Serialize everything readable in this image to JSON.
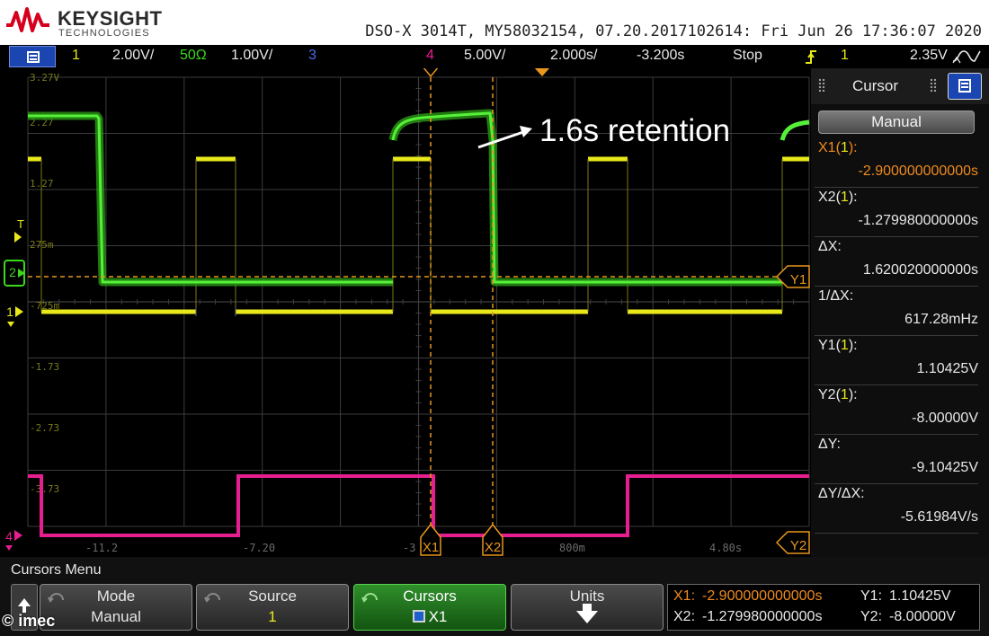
{
  "header": {
    "brand": "KEYSIGHT",
    "brand_sub": "TECHNOLOGIES",
    "device_info": "DSO-X 3014T, MY58032154, 07.20.2017102614: Fri Jun 26 17:36:07 2020"
  },
  "channel_bar": {
    "ch1_num": "1",
    "ch1_scale": "2.00V/",
    "ch2_num": "50Ω",
    "ch2_scale": "1.00V/",
    "ch3_num": "3",
    "ch4_num": "4",
    "ch4_scale": "5.00V/",
    "timebase": "2.000s/",
    "delay": "-3.200s",
    "run_state": "Stop",
    "trigger_source": "1",
    "trigger_level": "2.35V"
  },
  "screen": {
    "grid_labels": [
      "3.27V",
      "2.27",
      "1.27",
      "275m",
      "-725m",
      "-1.73",
      "-2.73",
      "-3.73"
    ],
    "time_labels": [
      "-11.2",
      "-7.20",
      "-3",
      "800m",
      "4.80s"
    ],
    "annotation": "1.6s retention",
    "markers": {
      "trigger": "T",
      "ch2": "2",
      "ch1": "1",
      "ch4": "4",
      "x1": "X1",
      "x2": "X2",
      "y1": "Y1",
      "y2": "Y2"
    },
    "colors": {
      "ch1": "#e8e81a",
      "ch2": "#3cd81c",
      "ch4": "#e61e90",
      "cursor": "#e8961c",
      "grid": "#3c3c3c"
    }
  },
  "cursor_panel": {
    "title": "Cursor",
    "mode": "Manual",
    "rows": [
      {
        "label_text": "X1(",
        "label_ch": "1",
        "label_end": "):",
        "value": "-2.900000000000s",
        "color": "#f08a1e"
      },
      {
        "label_text": "X2(",
        "label_ch": "1",
        "label_end": "):",
        "value": "-1.279980000000s",
        "color": "#e8e8e8"
      },
      {
        "label_text": "ΔX:",
        "label_ch": "",
        "label_end": "",
        "value": "1.620020000000s",
        "color": "#e8e8e8"
      },
      {
        "label_text": "1/ΔX:",
        "label_ch": "",
        "label_end": "",
        "value": "617.28mHz",
        "color": "#e8e8e8"
      },
      {
        "label_text": "Y1(",
        "label_ch": "1",
        "label_end": "):",
        "value": "1.10425V",
        "color": "#e8e8e8"
      },
      {
        "label_text": "Y2(",
        "label_ch": "1",
        "label_end": "):",
        "value": "-8.00000V",
        "color": "#e8e8e8"
      },
      {
        "label_text": "ΔY:",
        "label_ch": "",
        "label_end": "",
        "value": "-9.10425V",
        "color": "#e8e8e8"
      },
      {
        "label_text": "ΔY/ΔX:",
        "label_ch": "",
        "label_end": "",
        "value": "-5.61984V/s",
        "color": "#e8e8e8"
      }
    ]
  },
  "softkeys": {
    "menu_title": "Cursors Menu",
    "mode_label": "Mode",
    "mode_value": "Manual",
    "source_label": "Source",
    "source_value": "1",
    "cursors_label": "Cursors",
    "cursors_value": "X1",
    "units_label": "Units"
  },
  "readout": {
    "x1_label": "X1:",
    "x1_value": "-2.900000000000s",
    "x2_label": "X2:",
    "x2_value": "-1.279980000000s",
    "y1_label": "Y1:",
    "y1_value": "1.10425V",
    "y2_label": "Y2:",
    "y2_value": "-8.00000V"
  },
  "copyright": "© imec"
}
